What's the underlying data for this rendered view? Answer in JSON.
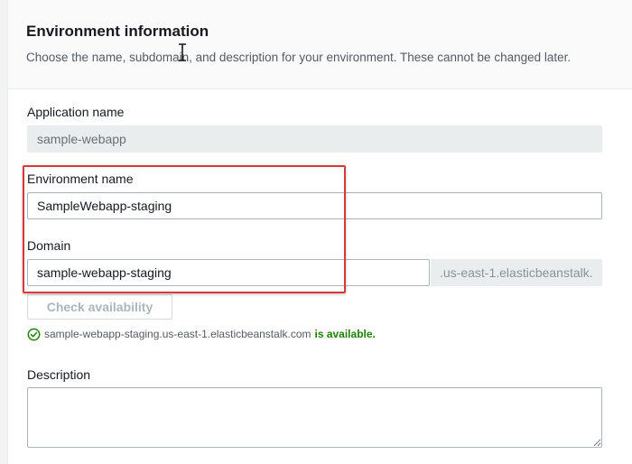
{
  "section": {
    "title": "Environment information",
    "description": "Choose the name, subdomain, and description for your environment. These cannot be changed later."
  },
  "application_name": {
    "label": "Application name",
    "value": "sample-webapp"
  },
  "environment_name": {
    "label": "Environment name",
    "value": "SampleWebapp-staging"
  },
  "domain": {
    "label": "Domain",
    "value": "sample-webapp-staging",
    "suffix": ".us-east-1.elasticbeanstalk."
  },
  "check_availability": {
    "label": "Check availability"
  },
  "availability_status": {
    "domain": "sample-webapp-staging.us-east-1.elasticbeanstalk.com",
    "status": "is available."
  },
  "description": {
    "label": "Description",
    "value": ""
  },
  "colors": {
    "highlight_border": "#d9383b",
    "success_green": "#1d8102",
    "disabled_bg": "#eaeded"
  },
  "icons": {
    "cursor": "text-cursor-icon",
    "status": "check-circle-icon",
    "resize": "resize-grip-icon"
  }
}
